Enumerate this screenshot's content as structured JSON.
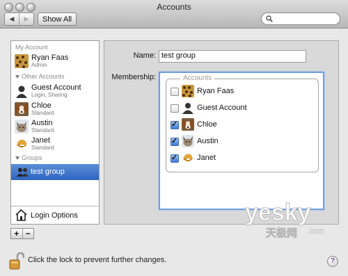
{
  "window": {
    "title": "Accounts"
  },
  "toolbar": {
    "back": "◀",
    "forward": "▶",
    "show_all": "Show All",
    "search_placeholder": ""
  },
  "sidebar": {
    "my_account_header": "My Account",
    "my_account": {
      "name": "Ryan Faas",
      "role": "Admin"
    },
    "other_header": "Other Accounts",
    "others": [
      {
        "name": "Guest Account",
        "role": "Login, Sharing"
      },
      {
        "name": "Chloe",
        "role": "Standard"
      },
      {
        "name": "Austin",
        "role": "Standard"
      },
      {
        "name": "Janet",
        "role": "Standard"
      }
    ],
    "groups_header": "Groups",
    "group": {
      "name": "test group"
    },
    "login_options": "Login Options",
    "add": "+",
    "remove": "−"
  },
  "detail": {
    "name_label": "Name:",
    "name_value": "test group",
    "membership_label": "Membership:",
    "accounts_legend": "Accounts",
    "members": [
      {
        "name": "Ryan Faas",
        "checked": false
      },
      {
        "name": "Guest Account",
        "checked": false
      },
      {
        "name": "Chloe",
        "checked": true
      },
      {
        "name": "Austin",
        "checked": true
      },
      {
        "name": "Janet",
        "checked": true
      }
    ]
  },
  "footer": {
    "lock_text": "Click the lock to prevent further changes.",
    "help": "?"
  },
  "watermark": {
    "brand": "yesky",
    "chinese": "天极网",
    "domain": ".com"
  },
  "colors": {
    "selection": "#3a6fcc",
    "focus": "#6f9ee8"
  }
}
